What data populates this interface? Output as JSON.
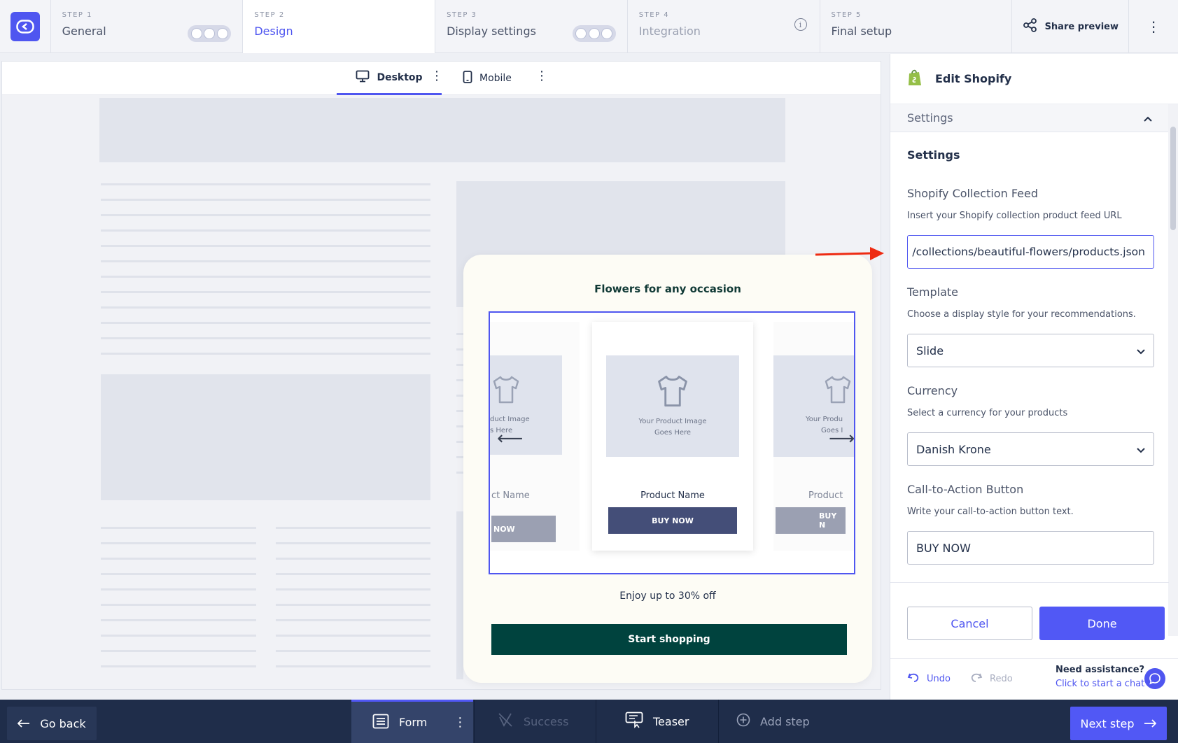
{
  "steps": [
    {
      "num": "STEP 1",
      "title": "General"
    },
    {
      "num": "STEP 2",
      "title": "Design"
    },
    {
      "num": "STEP 3",
      "title": "Display settings"
    },
    {
      "num": "STEP 4",
      "title": "Integration"
    },
    {
      "num": "STEP 5",
      "title": "Final setup"
    }
  ],
  "topbar": {
    "share_label": "Share preview"
  },
  "device_tabs": {
    "desktop": "Desktop",
    "mobile": "Mobile"
  },
  "popup": {
    "title": "Flowers for any occasion",
    "image_caption_1": "Your Product Image",
    "image_caption_2": "Goes Here",
    "left_caption_1": "duct Image",
    "left_caption_2": "s Here",
    "right_caption_1": "Your Produ",
    "right_caption_2": "Goes I",
    "product_name": "Product Name",
    "left_product_name": "ct Name",
    "right_product_name": "Product",
    "buy_label": "BUY NOW",
    "left_buy_label": "NOW",
    "right_buy_label": "BUY N",
    "promo": "Enjoy up to 30% off",
    "start_label": "Start shopping"
  },
  "panel": {
    "title": "Edit Shopify",
    "accordion": "Settings",
    "section_title": "Settings",
    "feed_label": "Shopify Collection Feed",
    "feed_help": "Insert your Shopify collection product feed URL",
    "feed_value": "/collections/beautiful-flowers/products.json",
    "template_label": "Template",
    "template_help": "Choose a display style for your recommendations.",
    "template_value": "Slide",
    "currency_label": "Currency",
    "currency_help": "Select a currency for your products",
    "currency_value": "Danish Krone",
    "cta_label": "Call-to-Action Button",
    "cta_help": "Write your call-to-action button text.",
    "cta_value": "BUY NOW",
    "cancel_label": "Cancel",
    "done_label": "Done",
    "undo_label": "Undo",
    "redo_label": "Redo",
    "assist_title": "Need assistance?",
    "assist_link": "Click to start a chat"
  },
  "bottombar": {
    "go_back": "Go back",
    "form": "Form",
    "success": "Success",
    "teaser": "Teaser",
    "add_step": "Add step",
    "next_step": "Next step"
  },
  "colors": {
    "accent": "#4f56f0",
    "popup_button": "#00433e",
    "bottom_bar": "#1f2d4a",
    "arrow_annotation": "#ee2b12"
  }
}
